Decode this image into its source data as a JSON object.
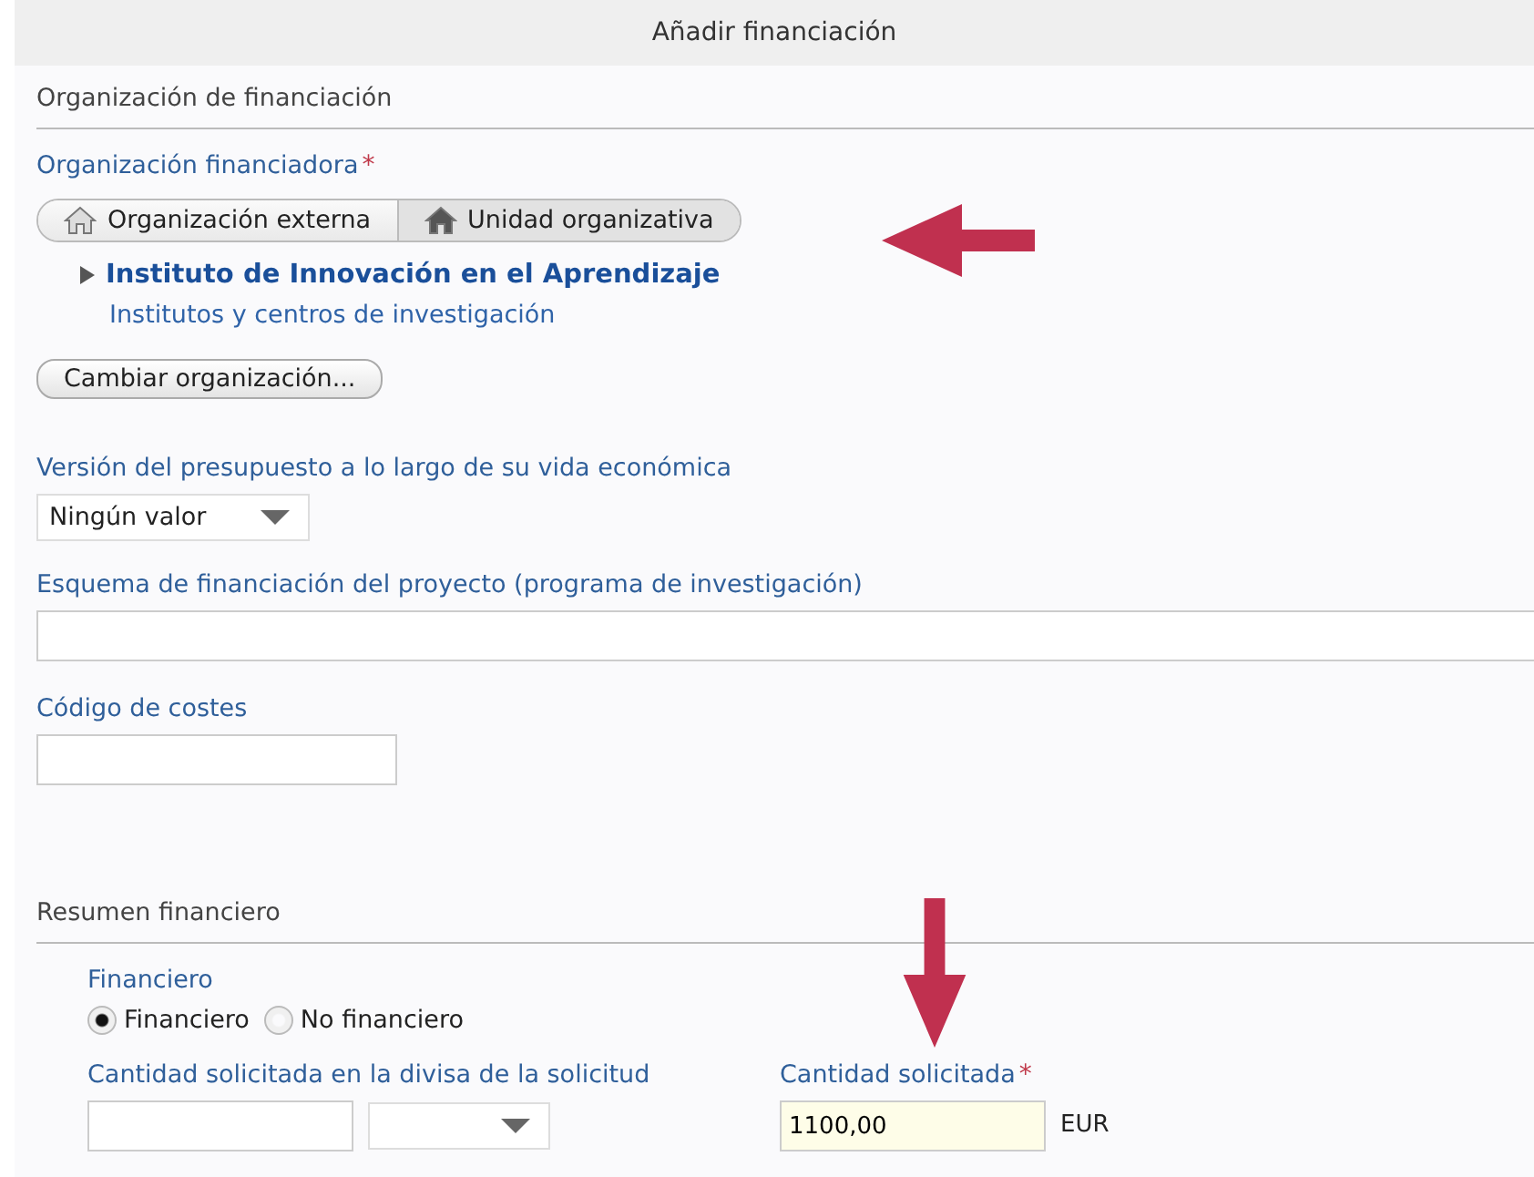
{
  "window": {
    "title": "Añadir financiación"
  },
  "funding_section": {
    "heading": "Organización de financiación",
    "org_label": "Organización financiadora",
    "org_required_mark": "*",
    "org_type_toggle": [
      {
        "label": "Organización externa",
        "selected": false
      },
      {
        "label": "Unidad organizativa",
        "selected": true
      }
    ],
    "org_tree": {
      "name": "Instituto de Innovación en el Aprendizaje",
      "expanded": false,
      "parent": "Institutos y centros de investigación"
    },
    "change_button": "Cambiar organización...",
    "budget_version": {
      "label": "Versión del presupuesto a lo largo de su vida económica",
      "value": "Ningún valor"
    },
    "scheme": {
      "label": "Esquema de financiación del proyecto (programa de investigación)"
    },
    "cost_code": {
      "label": "Código de costes"
    }
  },
  "summary_section": {
    "heading": "Resumen financiero",
    "financial": {
      "label": "Financiero",
      "options": [
        {
          "label": "Financiero",
          "selected": true
        },
        {
          "label": "No financiero",
          "selected": false
        }
      ]
    },
    "amount_in_currency": {
      "label": "Cantidad solicitada en la divisa de la solicitud"
    },
    "amount": {
      "label": "Cantidad solicitada",
      "required_mark": "*",
      "value": "1100,00",
      "currency": "EUR"
    }
  }
}
